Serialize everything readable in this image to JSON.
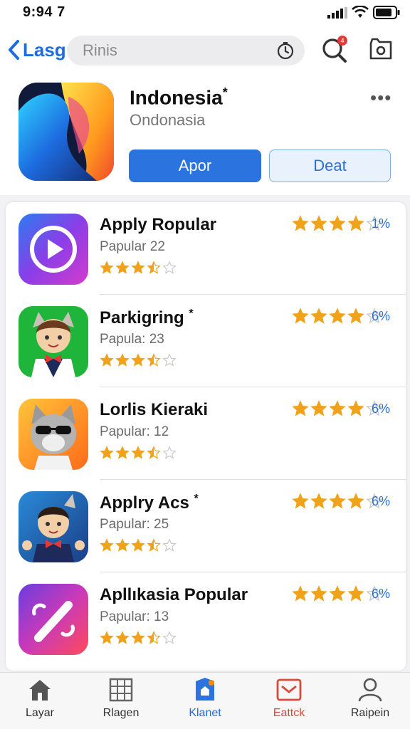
{
  "status_bar": {
    "time": "9:94 7"
  },
  "nav": {
    "back_label": "Lasg",
    "search_placeholder": "Rinis"
  },
  "featured": {
    "title": "Indonesia",
    "title_mark": "*",
    "subtitle": "Ondonasia",
    "primary_button": "Apor",
    "secondary_button": "Deat"
  },
  "apps": [
    {
      "name": "Apply Ropular",
      "meta": "Papular 22",
      "rating_big": 4,
      "pct": "1%"
    },
    {
      "name": "Parkigring",
      "name_mark": "*",
      "meta": "Papula: 23",
      "rating_big": 4,
      "pct": "6%"
    },
    {
      "name": "Lorlis Kieraki",
      "meta": "Papular: 12",
      "rating_big": 4,
      "pct": "6%"
    },
    {
      "name": "Applry Acs",
      "name_mark": "*",
      "meta": "Papular: 25",
      "rating_big": 4,
      "pct": "6%"
    },
    {
      "name": "Apllıkasia Popular",
      "meta": "Papular: 13",
      "rating_big": 4,
      "pct": "6%"
    }
  ],
  "tabs": [
    {
      "label": "Layar",
      "icon": "home-icon"
    },
    {
      "label": "Rlagen",
      "icon": "grid-icon"
    },
    {
      "label": "Klanet",
      "icon": "bookmark-icon",
      "active": true
    },
    {
      "label": "Eattck",
      "icon": "inbox-icon"
    },
    {
      "label": "Raipein",
      "icon": "person-icon"
    }
  ],
  "colors": {
    "accent": "#2b74e0",
    "star": "#f0a21a",
    "star_empty": "#c9c9c9"
  }
}
